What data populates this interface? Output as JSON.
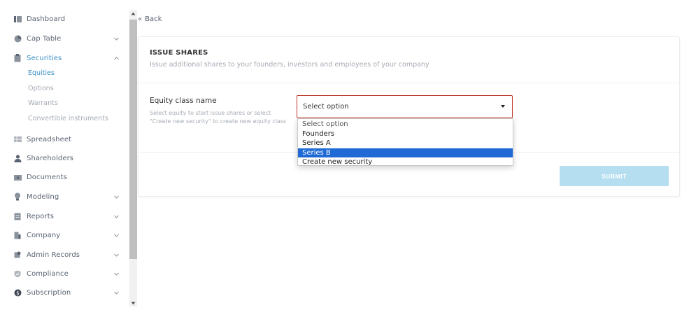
{
  "sidebar": {
    "items": [
      {
        "label": "Dashboard",
        "icon": "dashboard-icon",
        "has_chevron": false
      },
      {
        "label": "Cap Table",
        "icon": "pie-chart-icon",
        "has_chevron": true,
        "chevron": "down"
      },
      {
        "label": "Securities",
        "icon": "clipboard-icon",
        "has_chevron": true,
        "chevron": "up",
        "active": true
      },
      {
        "label": "Spreadsheet",
        "icon": "spreadsheet-icon",
        "has_chevron": false
      },
      {
        "label": "Shareholders",
        "icon": "person-icon",
        "has_chevron": false
      },
      {
        "label": "Documents",
        "icon": "folder-icon",
        "has_chevron": false
      },
      {
        "label": "Modeling",
        "icon": "lightbulb-icon",
        "has_chevron": true,
        "chevron": "down"
      },
      {
        "label": "Reports",
        "icon": "report-icon",
        "has_chevron": true,
        "chevron": "down"
      },
      {
        "label": "Company",
        "icon": "building-icon",
        "has_chevron": true,
        "chevron": "down"
      },
      {
        "label": "Admin Records",
        "icon": "admin-records-icon",
        "has_chevron": true,
        "chevron": "down"
      },
      {
        "label": "Compliance",
        "icon": "shield-check-icon",
        "has_chevron": true,
        "chevron": "down"
      },
      {
        "label": "Subscription",
        "icon": "dollar-circle-icon",
        "has_chevron": true,
        "chevron": "down"
      }
    ],
    "securities_sub": [
      {
        "label": "Equities",
        "active": true
      },
      {
        "label": "Options",
        "active": false
      },
      {
        "label": "Warrants",
        "active": false
      },
      {
        "label": "Convertible instruments",
        "active": false
      }
    ]
  },
  "main": {
    "back_label": "Back",
    "card": {
      "title": "ISSUE SHARES",
      "subtitle": "Issue additional shares to your founders, investors and employees of your company",
      "field_label": "Equity class name",
      "field_help": "Select equity to start issue shares or select \"Create new security\" to create new equity class",
      "select_value": "Select option",
      "options": [
        "Select option",
        "Founders",
        "Series A",
        "Series B",
        "Create new security"
      ],
      "highlighted_option": "Series B",
      "submit_label": "SUBMIT"
    }
  },
  "colors": {
    "accent": "#3a8fc4",
    "error_border": "#c0392b",
    "option_highlight": "#1f6ad4",
    "submit_disabled": "#b5dff0"
  }
}
